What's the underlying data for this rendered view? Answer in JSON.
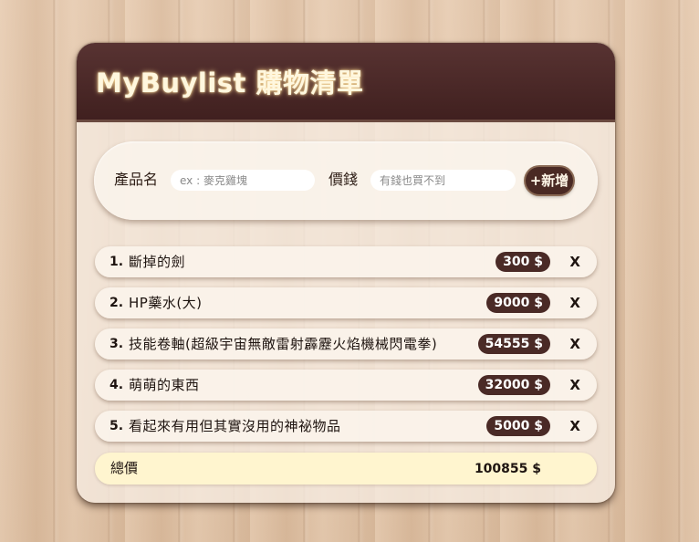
{
  "header": {
    "title": "MyBuylist 購物清單"
  },
  "form": {
    "name_label": "產品名",
    "name_placeholder": "ex : 麥克雞塊",
    "name_value": "",
    "price_label": "價錢",
    "price_placeholder": "有錢也買不到",
    "price_value": "",
    "add_label": "+新增"
  },
  "items": [
    {
      "index": "1.",
      "name": "斷掉的劍",
      "price": "300 $",
      "delete_label": "X"
    },
    {
      "index": "2.",
      "name": "HP藥水(大)",
      "price": "9000 $",
      "delete_label": "X"
    },
    {
      "index": "3.",
      "name": "技能卷軸(超級宇宙無敵雷射霹靂火焰機械閃電拳)",
      "price": "54555 $",
      "delete_label": "X"
    },
    {
      "index": "4.",
      "name": "萌萌的東西",
      "price": "32000 $",
      "delete_label": "X"
    },
    {
      "index": "5.",
      "name": "看起來有用但其實沒用的神祕物品",
      "price": "5000 $",
      "delete_label": "X"
    }
  ],
  "total": {
    "label": "總價",
    "value": "100855 $"
  },
  "colors": {
    "header_bg": "#40201f",
    "title_text": "#fff7de",
    "badge_bg": "#4a2a26",
    "total_bg": "#fff5cf"
  }
}
